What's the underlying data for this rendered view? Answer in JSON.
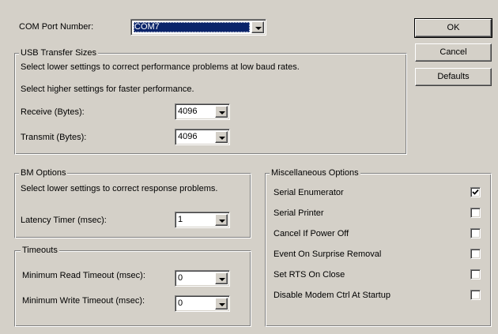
{
  "com_port": {
    "label": "COM Port Number:",
    "value": "COM7"
  },
  "buttons": {
    "ok": "OK",
    "cancel": "Cancel",
    "defaults": "Defaults"
  },
  "usb_transfer": {
    "title": "USB Transfer Sizes",
    "hint_low": "Select lower settings to correct performance problems at low baud rates.",
    "hint_high": "Select higher settings for faster performance.",
    "receive_label": "Receive (Bytes):",
    "receive_value": "4096",
    "transmit_label": "Transmit (Bytes):",
    "transmit_value": "4096"
  },
  "bm_options": {
    "title": "BM Options",
    "hint": "Select lower settings to correct response problems.",
    "latency_label": "Latency Timer (msec):",
    "latency_value": "1"
  },
  "timeouts": {
    "title": "Timeouts",
    "read_label": "Minimum Read Timeout (msec):",
    "read_value": "0",
    "write_label": "Minimum Write Timeout (msec):",
    "write_value": "0"
  },
  "misc": {
    "title": "Miscellaneous Options",
    "options": [
      {
        "label": "Serial Enumerator",
        "checked": true
      },
      {
        "label": "Serial Printer",
        "checked": false
      },
      {
        "label": "Cancel If Power Off",
        "checked": false
      },
      {
        "label": "Event On Surprise Removal",
        "checked": false
      },
      {
        "label": "Set RTS On Close",
        "checked": false
      },
      {
        "label": "Disable Modem Ctrl At Startup",
        "checked": false
      }
    ]
  },
  "icons": {
    "dropdown": "chevron-down-icon",
    "check": "checkmark-icon"
  }
}
